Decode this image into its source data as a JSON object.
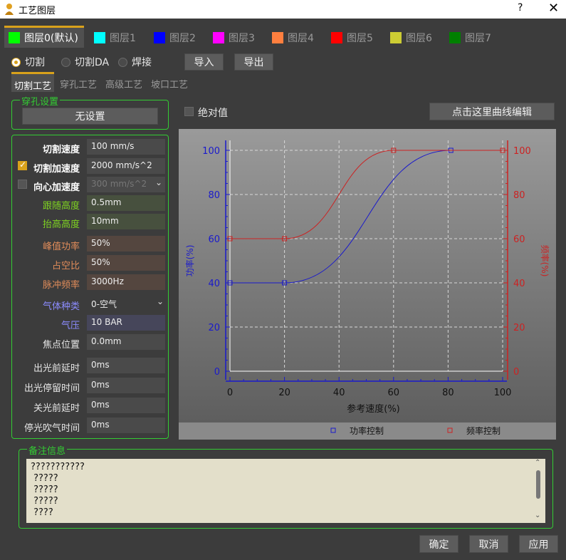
{
  "window": {
    "title": "工艺图层",
    "help": "?",
    "close": "✕"
  },
  "layers": [
    {
      "label": "图层0(默认)",
      "color": "#00ff00"
    },
    {
      "label": "图层1",
      "color": "#00ffff"
    },
    {
      "label": "图层2",
      "color": "#0000ff"
    },
    {
      "label": "图层3",
      "color": "#ff00ff"
    },
    {
      "label": "图层4",
      "color": "#ff7f3f"
    },
    {
      "label": "图层5",
      "color": "#ff0000"
    },
    {
      "label": "图层6",
      "color": "#cccc33"
    },
    {
      "label": "图层7",
      "color": "#008000"
    }
  ],
  "modes": {
    "cut": "切割",
    "cut_da": "切割DA",
    "weld": "焊接",
    "selected": "切割"
  },
  "toolbar": {
    "import": "导入",
    "export": "导出"
  },
  "subtabs": [
    "切割工艺",
    "穿孔工艺",
    "高级工艺",
    "坡口工艺"
  ],
  "pierce": {
    "title": "穿孔设置",
    "button": "无设置"
  },
  "params": {
    "cut_speed": {
      "label": "切割速度",
      "value": "100 mm/s"
    },
    "cut_accel": {
      "label": "切割加速度",
      "value": "2000 mm/s^2",
      "checked": true
    },
    "centripetal": {
      "label": "向心加速度",
      "value": "300 mm/s^2",
      "checked": false
    },
    "follow_height": {
      "label": "跟随高度",
      "value": "0.5mm"
    },
    "lift_height": {
      "label": "抬高高度",
      "value": "10mm"
    },
    "peak_power": {
      "label": "峰值功率",
      "value": "50%"
    },
    "duty": {
      "label": "占空比",
      "value": "50%"
    },
    "pulse_freq": {
      "label": "脉冲频率",
      "value": "3000Hz"
    },
    "gas_type": {
      "label": "气体种类",
      "value": "0-空气"
    },
    "gas_pressure": {
      "label": "气压",
      "value": "10 BAR"
    },
    "focus": {
      "label": "焦点位置",
      "value": "0.0mm"
    },
    "pre_delay": {
      "label": "出光前延时",
      "value": "0ms"
    },
    "dwell": {
      "label": "出光停留时间",
      "value": "0ms"
    },
    "off_delay": {
      "label": "关光前延时",
      "value": "0ms"
    },
    "blow_time": {
      "label": "停光吹气时间",
      "value": "0ms"
    }
  },
  "chart_controls": {
    "absolute": "绝对值",
    "edit_curve": "点击这里曲线编辑"
  },
  "chart_data": {
    "type": "line",
    "xlabel": "参考速度(%)",
    "ylabel": "功率(%)",
    "y2label": "频率(%)",
    "xlim": [
      0,
      100
    ],
    "ylim": [
      0,
      100
    ],
    "y2lim": [
      0,
      100
    ],
    "xticks": [
      0,
      20,
      40,
      60,
      80,
      100
    ],
    "yticks": [
      0,
      20,
      40,
      60,
      80,
      100
    ],
    "grid": true,
    "legend_position": "bottom",
    "series": [
      {
        "name": "功率控制",
        "color": "#1a1acc",
        "axis": "left",
        "points": [
          [
            0,
            40
          ],
          [
            20,
            40
          ],
          [
            81,
            100
          ],
          [
            100,
            100
          ]
        ]
      },
      {
        "name": "频率控制",
        "color": "#cc2222",
        "axis": "right",
        "points": [
          [
            0,
            60
          ],
          [
            20,
            60
          ],
          [
            60,
            100
          ],
          [
            100,
            100
          ]
        ]
      }
    ]
  },
  "notes": {
    "title": "备注信息",
    "lines": [
      "???????????",
      " ?????",
      " ?????",
      " ?????",
      " ????"
    ]
  },
  "footer": {
    "ok": "确定",
    "cancel": "取消",
    "apply": "应用"
  }
}
